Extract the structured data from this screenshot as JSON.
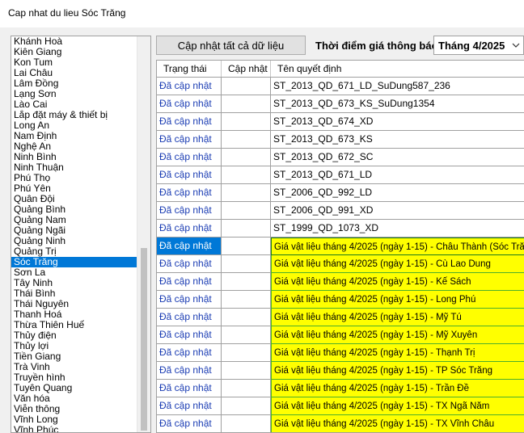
{
  "window": {
    "title": "Cap nhat du lieu Sóc Trăng"
  },
  "toolbar": {
    "update_all_label": "Cập nhật tất cả dữ liệu",
    "notice_time_label": "Thời điểm giá thông báo",
    "month_value": "Tháng 4/2025"
  },
  "provinces": {
    "selected": "Sóc Trăng",
    "items": [
      "Khánh Hoà",
      "Kiên Giang",
      "Kon Tum",
      "Lai Châu",
      "Lâm Đồng",
      "Lạng Sơn",
      "Lào Cai",
      "Lắp đặt máy & thiết bị",
      "Long An",
      "Nam Định",
      "Nghệ An",
      "Ninh Bình",
      "Ninh Thuận",
      "Phú Thọ",
      "Phú Yên",
      "Quân Đội",
      "Quảng Bình",
      "Quảng Nam",
      "Quảng Ngãi",
      "Quảng Ninh",
      "Quảng Trị",
      "Sóc Trăng",
      "Sơn La",
      "Tây Ninh",
      "Thái Bình",
      "Thái Nguyên",
      "Thanh Hoá",
      "Thừa Thiên Huế",
      "Thủy điện",
      "Thủy lợi",
      "Tiền Giang",
      "Trà Vinh",
      "Truyền hình",
      "Tuyên Quang",
      "Văn hóa",
      "Viễn thông",
      "Vĩnh Long",
      "Vĩnh Phúc"
    ]
  },
  "grid": {
    "columns": [
      "Trạng thái",
      "Cập nhật",
      "Tên quyết định"
    ],
    "selected_row": 9,
    "rows": [
      {
        "status": "Đã cập nhật",
        "update": "",
        "name": "ST_2013_QD_671_LD_SuDung587_236",
        "highlight": false
      },
      {
        "status": "Đã cập nhật",
        "update": "",
        "name": "ST_2013_QD_673_KS_SuDung1354",
        "highlight": false
      },
      {
        "status": "Đã cập nhật",
        "update": "",
        "name": "ST_2013_QD_674_XD",
        "highlight": false
      },
      {
        "status": "Đã cập nhật",
        "update": "",
        "name": "ST_2013_QD_673_KS",
        "highlight": false
      },
      {
        "status": "Đã cập nhật",
        "update": "",
        "name": "ST_2013_QD_672_SC",
        "highlight": false
      },
      {
        "status": "Đã cập nhật",
        "update": "",
        "name": "ST_2013_QD_671_LD",
        "highlight": false
      },
      {
        "status": "Đã cập nhật",
        "update": "",
        "name": "ST_2006_QD_992_LD",
        "highlight": false
      },
      {
        "status": "Đã cập nhật",
        "update": "",
        "name": "ST_2006_QD_991_XD",
        "highlight": false
      },
      {
        "status": "Đã cập nhật",
        "update": "",
        "name": "ST_1999_QD_1073_XD",
        "highlight": false
      },
      {
        "status": "Đã cập nhật",
        "update": "",
        "name": "Giá vật liệu tháng 4/2025 (ngày 1-15) - Châu Thành (Sóc Trăng)",
        "highlight": true
      },
      {
        "status": "Đã cập nhật",
        "update": "",
        "name": "Giá vật liệu tháng 4/2025 (ngày 1-15) - Cù Lao Dung",
        "highlight": true
      },
      {
        "status": "Đã cập nhật",
        "update": "",
        "name": "Giá vật liệu tháng 4/2025 (ngày 1-15) - Kế Sách",
        "highlight": true
      },
      {
        "status": "Đã cập nhật",
        "update": "",
        "name": "Giá vật liệu tháng 4/2025 (ngày 1-15) - Long Phú",
        "highlight": true
      },
      {
        "status": "Đã cập nhật",
        "update": "",
        "name": "Giá vật liệu tháng 4/2025 (ngày 1-15) - Mỹ Tú",
        "highlight": true
      },
      {
        "status": "Đã cập nhật",
        "update": "",
        "name": "Giá vật liệu tháng 4/2025 (ngày 1-15) - Mỹ Xuyên",
        "highlight": true
      },
      {
        "status": "Đã cập nhật",
        "update": "",
        "name": "Giá vật liệu tháng 4/2025 (ngày 1-15) - Thạnh Trị",
        "highlight": true
      },
      {
        "status": "Đã cập nhật",
        "update": "",
        "name": "Giá vật liệu tháng 4/2025 (ngày 1-15) - TP Sóc Trăng",
        "highlight": true
      },
      {
        "status": "Đã cập nhật",
        "update": "",
        "name": "Giá vật liệu tháng 4/2025 (ngày 1-15) - Trần Đề",
        "highlight": true
      },
      {
        "status": "Đã cập nhật",
        "update": "",
        "name": "Giá vật liệu tháng 4/2025 (ngày 1-15) - TX Ngã Năm",
        "highlight": true
      },
      {
        "status": "Đã cập nhật",
        "update": "",
        "name": "Giá vật liệu tháng 4/2025 (ngày 1-15) - TX Vĩnh Châu",
        "highlight": true
      }
    ]
  }
}
